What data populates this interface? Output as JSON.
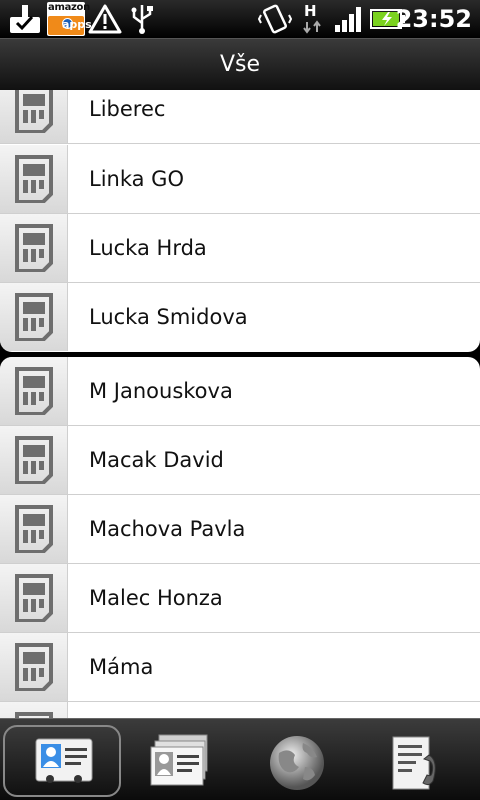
{
  "status_bar": {
    "icons": [
      "sd-card-check-icon",
      "amazon-apps-icon",
      "warning-icon",
      "usb-icon",
      "vibrate-icon",
      "hspa-data-icon",
      "signal-bars-icon",
      "battery-charging-icon"
    ],
    "amazon_label": "amazon",
    "amazon_badge": "apps",
    "network": "H",
    "time": "23:52"
  },
  "header": {
    "title": "Vše"
  },
  "contacts": {
    "group1": [
      {
        "name": "Liberec",
        "icon": "sim-card-icon"
      },
      {
        "name": "Linka GO",
        "icon": "sim-card-icon"
      },
      {
        "name": "Lucka Hrda",
        "icon": "sim-card-icon"
      },
      {
        "name": "Lucka Smidova",
        "icon": "sim-card-icon"
      }
    ],
    "group2": [
      {
        "name": "M Janouskova",
        "icon": "sim-card-icon"
      },
      {
        "name": "Macak David",
        "icon": "sim-card-icon"
      },
      {
        "name": "Machova Pavla",
        "icon": "sim-card-icon"
      },
      {
        "name": "Malec Honza",
        "icon": "sim-card-icon"
      },
      {
        "name": "Máma",
        "icon": "sim-card-icon"
      },
      {
        "name": "",
        "icon": "sim-card-icon"
      }
    ]
  },
  "tabs": [
    {
      "name": "contacts-tab",
      "icon": "contact-card-icon",
      "active": true
    },
    {
      "name": "groups-tab",
      "icon": "group-cards-icon",
      "active": false
    },
    {
      "name": "online-directories-tab",
      "icon": "globe-icon",
      "active": false
    },
    {
      "name": "call-history-tab",
      "icon": "call-log-icon",
      "active": false
    }
  ],
  "colors": {
    "status_bar": "#000000",
    "list_background": "#ffffff",
    "battery": "#7bd21f",
    "accent": "#f08a19"
  }
}
